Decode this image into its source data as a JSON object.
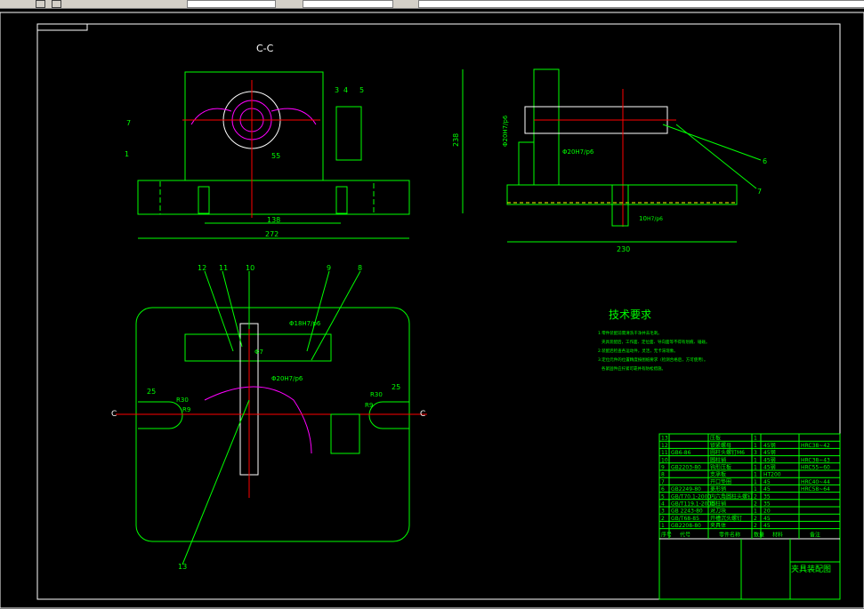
{
  "drawing": {
    "section_label": "C-C",
    "section_marks": [
      "C",
      "C"
    ],
    "tech_requirements": {
      "title": "技术要求",
      "lines": [
        "1.零件装配前需清洗干净并去毛刺。",
        "夹具装配后，工作面、定位面、导向面等不得有划痕、磕碰。",
        "2.装配后检查各运动件，灵活，无卡滞现象。",
        "3.定位元件的位置精度按图纸要求（检测合格后，方可使用）。",
        "各紧固件应拧紧可靠并有防松措施。"
      ]
    },
    "dimensions": {
      "top_55": "55",
      "top_138": "138",
      "top_272": "272",
      "side_238": "238",
      "side_230": "230",
      "side_fit1": "Φ20H7/p6",
      "side_fit2": "Φ20H7/p6",
      "side_10": "10",
      "side_fit3": "H7/p6",
      "plan_fit1": "Φ18H7/p6",
      "plan_fit2": "Φ20H7/p6",
      "plan_fit3": "Φ7",
      "left_25": "25",
      "right_25": "25",
      "left_r1": "R30",
      "left_r2": "R9",
      "right_r1": "R30",
      "right_r2": "R9"
    },
    "balloons": {
      "front": [
        "7",
        "1",
        "3",
        "4",
        "5"
      ],
      "side": [
        "6",
        "7"
      ],
      "plan": [
        "12",
        "11",
        "10",
        "9",
        "8",
        "13"
      ]
    },
    "parts_list": {
      "header": [
        "序号",
        "代号",
        "零件名称",
        "数量",
        "材料",
        "备注"
      ],
      "rows": [
        [
          "13",
          "",
          "压板",
          "1",
          "",
          ""
        ],
        [
          "12",
          "",
          "锁紧螺母",
          "1",
          "45钢",
          "HRC38~42"
        ],
        [
          "11",
          "GB6-86",
          "圆柱头螺钉M6",
          "3",
          "45钢",
          ""
        ],
        [
          "10",
          "",
          "圆柱销",
          "1",
          "45钢",
          "HRC38~43"
        ],
        [
          "9",
          "GB2203-80",
          "钩形压板",
          "1",
          "45钢",
          "HRC55~60"
        ],
        [
          "8",
          "",
          "支承板",
          "1",
          "HT200",
          ""
        ],
        [
          "7",
          "",
          "开口垫圈",
          "1",
          "45",
          "HRC40~44"
        ],
        [
          "6",
          "GB2249-80",
          "菱形销",
          "1",
          "45",
          "HRC58~64"
        ],
        [
          "5",
          "GB/T70.1-2000",
          "内六角圆柱头螺钉",
          "2",
          "35",
          ""
        ],
        [
          "4",
          "GB/T119.1-2000",
          "圆柱销",
          "2",
          "35",
          ""
        ],
        [
          "3",
          "GB 2243-80",
          "对刀块",
          "1",
          "20",
          ""
        ],
        [
          "2",
          "GB/T68-85",
          "开槽沉头螺钉",
          "2",
          "45",
          ""
        ],
        [
          "1",
          "GB2208-80",
          "夹具体",
          "2",
          "45",
          ""
        ]
      ]
    },
    "title_block": {
      "title": "夹具装配图"
    },
    "colors": {
      "outline": "#00ff00",
      "white": "#ffffff",
      "magenta": "#ff00ff",
      "red": "#ff0000",
      "yellow": "#ffff00",
      "background": "#000000"
    }
  }
}
